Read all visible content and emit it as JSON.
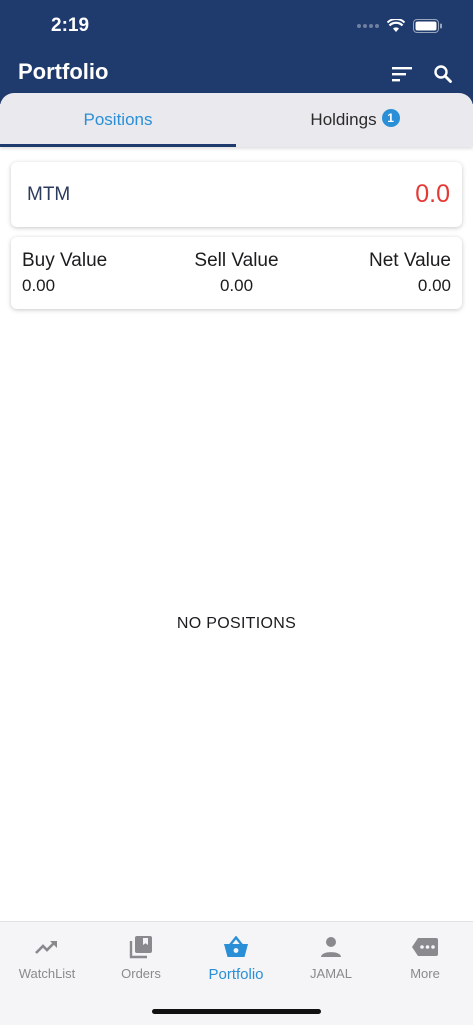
{
  "status": {
    "time": "2:19"
  },
  "header": {
    "title": "Portfolio"
  },
  "tabs": [
    {
      "label": "Positions",
      "active": true
    },
    {
      "label": "Holdings",
      "badge": "1",
      "active": false
    }
  ],
  "mtm": {
    "label": "MTM",
    "value": "0.0",
    "value_color": "#e53935"
  },
  "values": {
    "buy": {
      "label": "Buy Value",
      "value": "0.00"
    },
    "sell": {
      "label": "Sell Value",
      "value": "0.00"
    },
    "net": {
      "label": "Net Value",
      "value": "0.00"
    }
  },
  "empty_message": "NO POSITIONS",
  "tabbar": [
    {
      "label": "WatchList",
      "icon": "trending-up-icon"
    },
    {
      "label": "Orders",
      "icon": "orders-icon"
    },
    {
      "label": "Portfolio",
      "icon": "basket-icon",
      "active": true
    },
    {
      "label": "JAMAL",
      "icon": "person-icon"
    },
    {
      "label": "More",
      "icon": "more-icon"
    }
  ],
  "colors": {
    "header": "#1f3a6d",
    "accent": "#2a8fd6",
    "loss": "#e53935"
  }
}
